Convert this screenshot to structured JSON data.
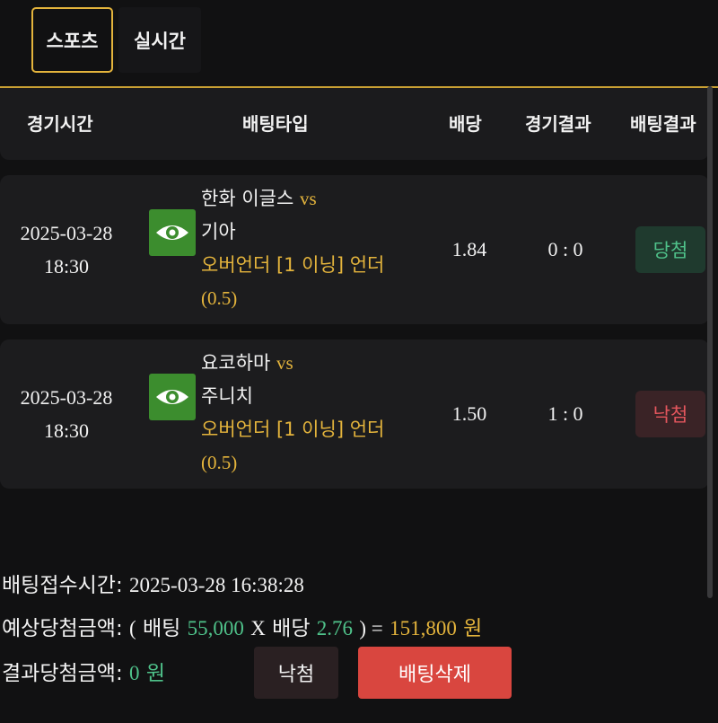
{
  "tabs": [
    {
      "label": "스포츠",
      "active": true
    },
    {
      "label": "실시간",
      "active": false
    }
  ],
  "colors": {
    "accent": "#e4b43c",
    "win": "#4fc28a",
    "lose": "#e4565d",
    "delete": "#d9463f",
    "eye": "#3c8d2e"
  },
  "table": {
    "headers": [
      "경기시간",
      "배팅타입",
      "배당",
      "경기결과",
      "배팅결과"
    ],
    "rows": [
      {
        "date": "2025-03-28",
        "time": "18:30",
        "icon": "eye-icon",
        "home": "한화 이글스",
        "vs": "vs",
        "away": "기아",
        "market": "오버언더 [1 이닝] 언더",
        "line": "(0.5)",
        "odds": "1.84",
        "score": "0 : 0",
        "result": "당첨"
      },
      {
        "date": "2025-03-28",
        "time": "18:30",
        "icon": "eye-icon",
        "home": "요코하마",
        "vs": "vs",
        "away": "주니치",
        "market": "오버언더 [1 이닝] 언더",
        "line": "(0.5)",
        "odds": "1.50",
        "score": "1 : 0",
        "result": "낙첨"
      }
    ]
  },
  "summary": {
    "received_label": "배팅접수시간:",
    "received_value": "2025-03-28 16:38:28",
    "expected_label": "예상당첨금액:",
    "open_paren": "(",
    "bet_label": "배팅",
    "bet_amount": "55,000",
    "times": "X",
    "odds_label": "배당",
    "odds_value": "2.76",
    "close_eq": ") =",
    "expected_amount": "151,800",
    "won": "원",
    "result_label": "결과당첨금액:",
    "result_amount": "0",
    "result_won": "원"
  },
  "buttons": {
    "result": "낙첨",
    "delete": "배팅삭제"
  }
}
